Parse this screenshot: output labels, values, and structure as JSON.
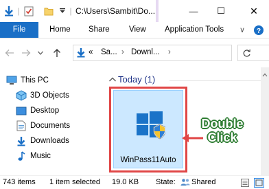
{
  "window": {
    "title": "C:\\Users\\Sambit\\Do...",
    "controls": {
      "minimize": "—",
      "maximize": "☐",
      "close": "✕"
    }
  },
  "quick_access": {
    "icons": [
      "down-arrow-icon",
      "properties-check-icon",
      "new-folder-icon",
      "customize-dropdown-icon"
    ],
    "separator": "|"
  },
  "ribbon": {
    "tabs": [
      "File",
      "Home",
      "Share",
      "View",
      "Application Tools"
    ],
    "toggle_glyph": "∨",
    "help_glyph": "?"
  },
  "addressbar": {
    "overflow": "«",
    "breadcrumbs": [
      "Sa...",
      "Downl..."
    ],
    "separator": "›"
  },
  "nav_pane": {
    "items": [
      {
        "label": "This PC",
        "icon": "pc-icon"
      },
      {
        "label": "3D Objects",
        "icon": "3d-objects-icon"
      },
      {
        "label": "Desktop",
        "icon": "desktop-icon"
      },
      {
        "label": "Documents",
        "icon": "documents-icon"
      },
      {
        "label": "Downloads",
        "icon": "downloads-icon"
      },
      {
        "label": "Music",
        "icon": "music-icon"
      }
    ]
  },
  "content": {
    "group": "Today (1)",
    "file": {
      "name": "WinPass11Auto",
      "icon": "installer-shield-icon",
      "selected": true
    }
  },
  "annotation": {
    "line1": "Double",
    "line2": "Click",
    "color": "#2e7d32",
    "box_color": "#e04646"
  },
  "status": {
    "items_count": "743 items",
    "selection": "1 item selected",
    "size": "19.0 KB",
    "state_label": "State:",
    "state_value": "Shared"
  },
  "colors": {
    "accent": "#1a6fc6",
    "selection": "#cce8ff",
    "group_title": "#1e3287"
  }
}
